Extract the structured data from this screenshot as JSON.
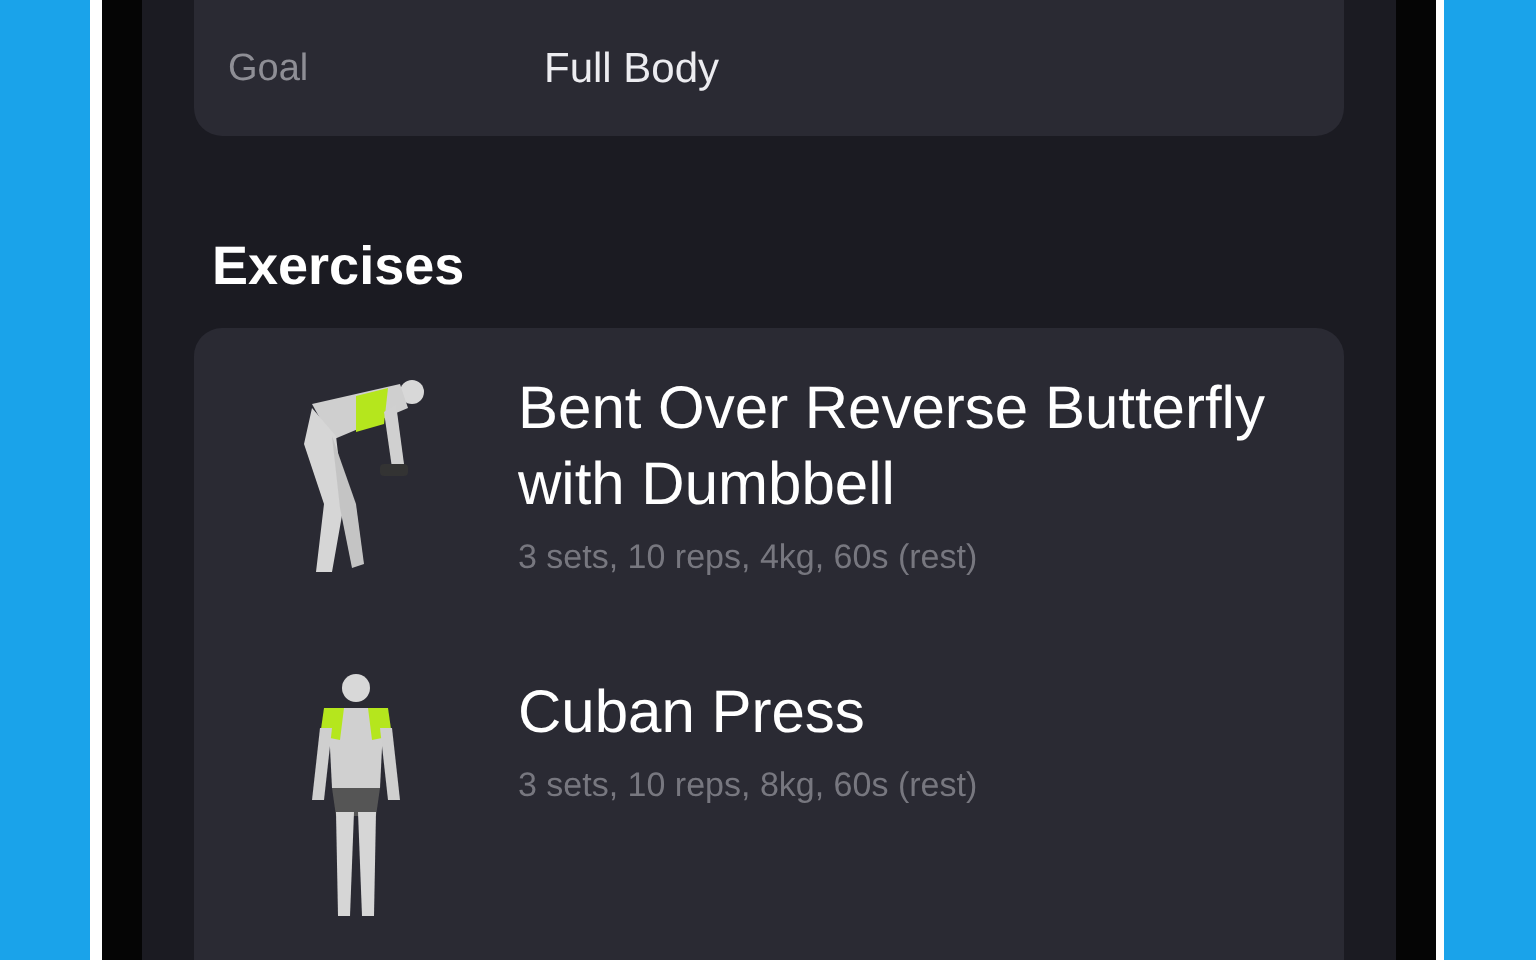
{
  "summary": {
    "label": "Goal",
    "value": "Full Body"
  },
  "section_title": "Exercises",
  "exercises": [
    {
      "kind": "bent",
      "name": "Bent Over Reverse Butterfly with Dumbbell",
      "details": "3 sets, 10 reps, 4kg, 60s (rest)"
    },
    {
      "kind": "standing",
      "name": "Cuban Press",
      "details": "3 sets, 10 reps, 8kg, 60s (rest)"
    }
  ]
}
